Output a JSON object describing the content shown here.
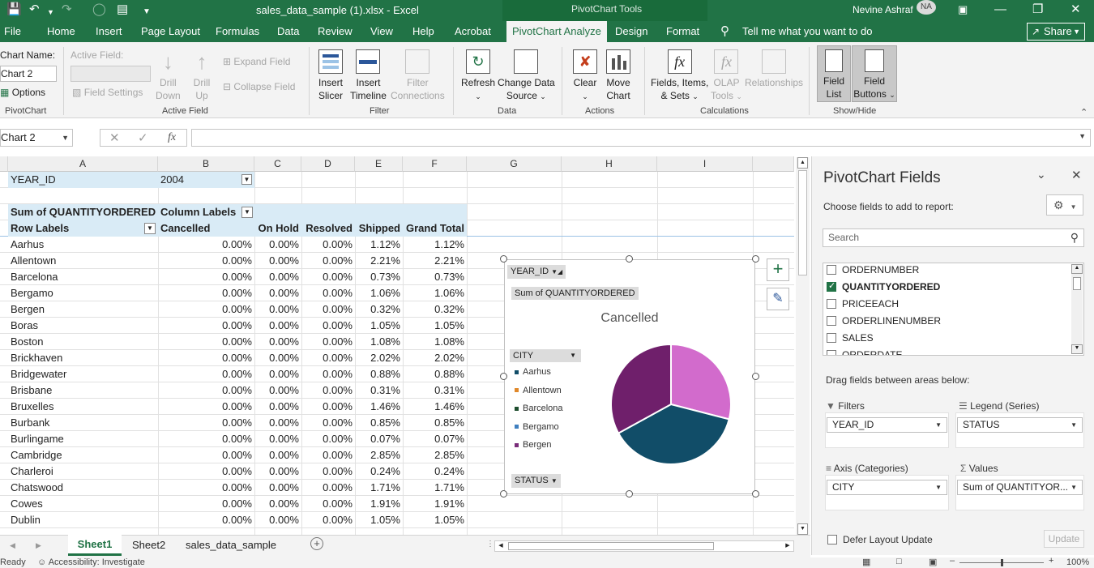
{
  "app": {
    "title": "sales_data_sample (1).xlsx  -  Excel",
    "context_tools": "PivotChart Tools",
    "user": "Nevine Ashraf",
    "user_initials": "NA",
    "accent": "#217346"
  },
  "tabs": [
    "File",
    "Home",
    "Insert",
    "Page Layout",
    "Formulas",
    "Data",
    "Review",
    "View",
    "Help",
    "Acrobat",
    "PivotChart Analyze",
    "Design",
    "Format"
  ],
  "tell_me": "Tell me what you want to do",
  "share": "Share",
  "ribbon": {
    "chart_name_label": "Chart Name:",
    "chart_name_value": "Chart 2",
    "options": "Options",
    "pivotchart_group": "PivotChart",
    "active_field_label": "Active Field:",
    "field_settings": "Field Settings",
    "drill_down": [
      "Drill",
      "Down"
    ],
    "drill_up": [
      "Drill",
      "Up"
    ],
    "expand_field": "Expand Field",
    "collapse_field": "Collapse Field",
    "active_field_group": "Active Field",
    "insert_slicer": [
      "Insert",
      "Slicer"
    ],
    "insert_timeline": [
      "Insert",
      "Timeline"
    ],
    "filter_connections": [
      "Filter",
      "Connections"
    ],
    "filter_group": "Filter",
    "refresh": "Refresh",
    "change_data_source": [
      "Change Data",
      "Source"
    ],
    "data_group": "Data",
    "clear": "Clear",
    "move_chart": [
      "Move",
      "Chart"
    ],
    "actions_group": "Actions",
    "fields_items_sets": [
      "Fields, Items,",
      "& Sets"
    ],
    "olap_tools": [
      "OLAP",
      "Tools"
    ],
    "relationships": "Relationships",
    "calculations_group": "Calculations",
    "field_list": [
      "Field",
      "List"
    ],
    "field_buttons": [
      "Field",
      "Buttons"
    ],
    "showhide_group": "Show/Hide"
  },
  "namebox": "Chart 2",
  "columns": [
    "A",
    "B",
    "C",
    "D",
    "E",
    "F",
    "G",
    "H",
    "I"
  ],
  "pivot": {
    "filter_field": "YEAR_ID",
    "filter_value": "2004",
    "measure": "Sum of QUANTITYORDERED",
    "column_labels": "Column Labels",
    "row_labels": "Row Labels",
    "headers": [
      "Cancelled",
      "On Hold",
      "Resolved",
      "Shipped",
      "Grand Total"
    ],
    "rows": [
      {
        "label": "Aarhus",
        "v": [
          "0.00%",
          "0.00%",
          "0.00%",
          "1.12%",
          "1.12%"
        ]
      },
      {
        "label": "Allentown",
        "v": [
          "0.00%",
          "0.00%",
          "0.00%",
          "2.21%",
          "2.21%"
        ]
      },
      {
        "label": "Barcelona",
        "v": [
          "0.00%",
          "0.00%",
          "0.00%",
          "0.73%",
          "0.73%"
        ]
      },
      {
        "label": "Bergamo",
        "v": [
          "0.00%",
          "0.00%",
          "0.00%",
          "1.06%",
          "1.06%"
        ]
      },
      {
        "label": "Bergen",
        "v": [
          "0.00%",
          "0.00%",
          "0.00%",
          "0.32%",
          "0.32%"
        ]
      },
      {
        "label": "Boras",
        "v": [
          "0.00%",
          "0.00%",
          "0.00%",
          "1.05%",
          "1.05%"
        ]
      },
      {
        "label": "Boston",
        "v": [
          "0.00%",
          "0.00%",
          "0.00%",
          "1.08%",
          "1.08%"
        ]
      },
      {
        "label": "Brickhaven",
        "v": [
          "0.00%",
          "0.00%",
          "0.00%",
          "2.02%",
          "2.02%"
        ]
      },
      {
        "label": "Bridgewater",
        "v": [
          "0.00%",
          "0.00%",
          "0.00%",
          "0.88%",
          "0.88%"
        ]
      },
      {
        "label": "Brisbane",
        "v": [
          "0.00%",
          "0.00%",
          "0.00%",
          "0.31%",
          "0.31%"
        ]
      },
      {
        "label": "Bruxelles",
        "v": [
          "0.00%",
          "0.00%",
          "0.00%",
          "1.46%",
          "1.46%"
        ]
      },
      {
        "label": "Burbank",
        "v": [
          "0.00%",
          "0.00%",
          "0.00%",
          "0.85%",
          "0.85%"
        ]
      },
      {
        "label": "Burlingame",
        "v": [
          "0.00%",
          "0.00%",
          "0.00%",
          "0.07%",
          "0.07%"
        ]
      },
      {
        "label": "Cambridge",
        "v": [
          "0.00%",
          "0.00%",
          "0.00%",
          "2.85%",
          "2.85%"
        ]
      },
      {
        "label": "Charleroi",
        "v": [
          "0.00%",
          "0.00%",
          "0.00%",
          "0.24%",
          "0.24%"
        ]
      },
      {
        "label": "Chatswood",
        "v": [
          "0.00%",
          "0.00%",
          "0.00%",
          "1.71%",
          "1.71%"
        ]
      },
      {
        "label": "Cowes",
        "v": [
          "0.00%",
          "0.00%",
          "0.00%",
          "1.91%",
          "1.91%"
        ]
      },
      {
        "label": "Dublin",
        "v": [
          "0.00%",
          "0.00%",
          "0.00%",
          "1.05%",
          "1.05%"
        ]
      }
    ]
  },
  "chart_data": {
    "type": "pie",
    "title": "Cancelled",
    "categories": [
      "Aarhus",
      "Allentown",
      "Barcelona",
      "Bergamo",
      "Bergen"
    ],
    "values": [
      29,
      38,
      33
    ],
    "slice_colors": [
      "#d26bcc",
      "#114d68",
      "#6f1f6b"
    ],
    "legend_colors": [
      "#114d68",
      "#e0882a",
      "#1e4e2e",
      "#3f7fbf",
      "#7a2d7a"
    ],
    "field_buttons": {
      "filter": "YEAR_ID",
      "values": "Sum of QUANTITYORDERED",
      "axis": "CITY",
      "legend": "STATUS"
    }
  },
  "fields_pane": {
    "title": "PivotChart Fields",
    "subtitle": "Choose fields to add to report:",
    "search_placeholder": "Search",
    "fields": [
      {
        "name": "ORDERNUMBER",
        "checked": false
      },
      {
        "name": "QUANTITYORDERED",
        "checked": true
      },
      {
        "name": "PRICEEACH",
        "checked": false
      },
      {
        "name": "ORDERLINENUMBER",
        "checked": false
      },
      {
        "name": "SALES",
        "checked": false
      },
      {
        "name": "ORDERDATE",
        "checked": false
      }
    ],
    "drag_label": "Drag fields between areas below:",
    "filters_title": "Filters",
    "filters_value": "YEAR_ID",
    "legend_title": "Legend (Series)",
    "legend_value": "STATUS",
    "axis_title": "Axis (Categories)",
    "axis_value": "CITY",
    "values_title": "Values",
    "values_value": "Sum of QUANTITYOR...",
    "defer_label": "Defer Layout Update",
    "update_button": "Update"
  },
  "sheets": [
    "Sheet1",
    "Sheet2",
    "sales_data_sample"
  ],
  "status": {
    "ready": "Ready",
    "accessibility": "Accessibility: Investigate",
    "zoom": "100%"
  }
}
